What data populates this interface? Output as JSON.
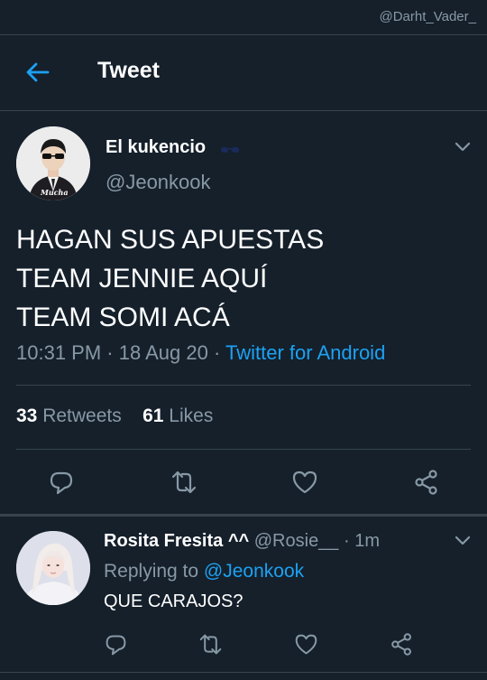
{
  "watermark": "@Darht_Vader_",
  "header": {
    "title": "Tweet"
  },
  "tweet": {
    "author_name": "El kukencio",
    "author_handle": "@Jeonkook",
    "avatar_caption": "Mucha",
    "lines": [
      "HAGAN SUS APUESTAS",
      "TEAM JENNIE AQUÍ",
      "TEAM SOMI ACÁ"
    ],
    "time": "10:31 PM",
    "sep1": " · ",
    "date": "18 Aug 20",
    "sep2": " · ",
    "source": "Twitter for Android",
    "retweet_count": "33",
    "retweet_label": "Retweets",
    "like_count": "61",
    "like_label": "Likes"
  },
  "reply": {
    "author_name": "Rosita Fresita ^^",
    "author_handle": "@Rosie__",
    "time": "· 1m",
    "replying_label": "Replying to",
    "replying_to": "@Jeonkook",
    "text": "QUE CARAJOS?"
  },
  "colors": {
    "background": "#15202b",
    "accent": "#1da1f2",
    "secondary_text": "#8899a6",
    "divider": "#38444d"
  },
  "icons": [
    "back-arrow-icon",
    "chevron-down-icon",
    "reply-icon",
    "retweet-icon",
    "like-icon",
    "share-icon",
    "sunglasses-emoji-icon"
  ]
}
